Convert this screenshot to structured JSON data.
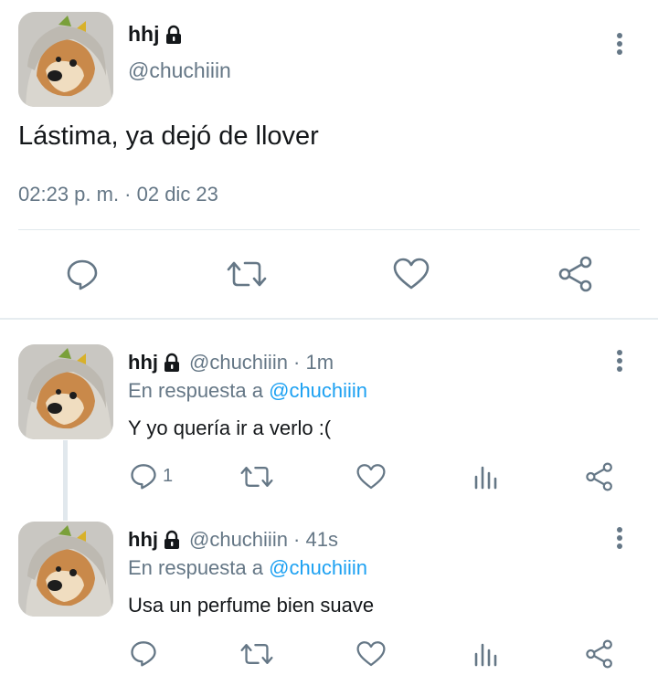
{
  "colors": {
    "accent": "#1da1f2",
    "muted": "#657786",
    "text": "#14171a"
  },
  "main_tweet": {
    "name": "hhj",
    "lock_icon": "lock-icon",
    "handle": "@chuchiiin",
    "text": "Lástima, ya dejó de llover",
    "timestamp": "02:23 p. m. · 02 dic 23",
    "actions": [
      "reply-icon",
      "retweet-icon",
      "like-icon",
      "share-icon"
    ]
  },
  "replies": [
    {
      "name": "hhj",
      "handle_time": "@chuchiiin · 1m",
      "reply_prefix": "En respuesta a",
      "reply_mention": "@chuchiiin",
      "text": "Y yo quería ir a verlo :(",
      "reply_count": "1"
    },
    {
      "name": "hhj",
      "handle_time": "@chuchiiin · 41s",
      "reply_prefix": "En respuesta a",
      "reply_mention": "@chuchiiin",
      "text": "Usa un perfume bien suave",
      "reply_count": ""
    }
  ]
}
